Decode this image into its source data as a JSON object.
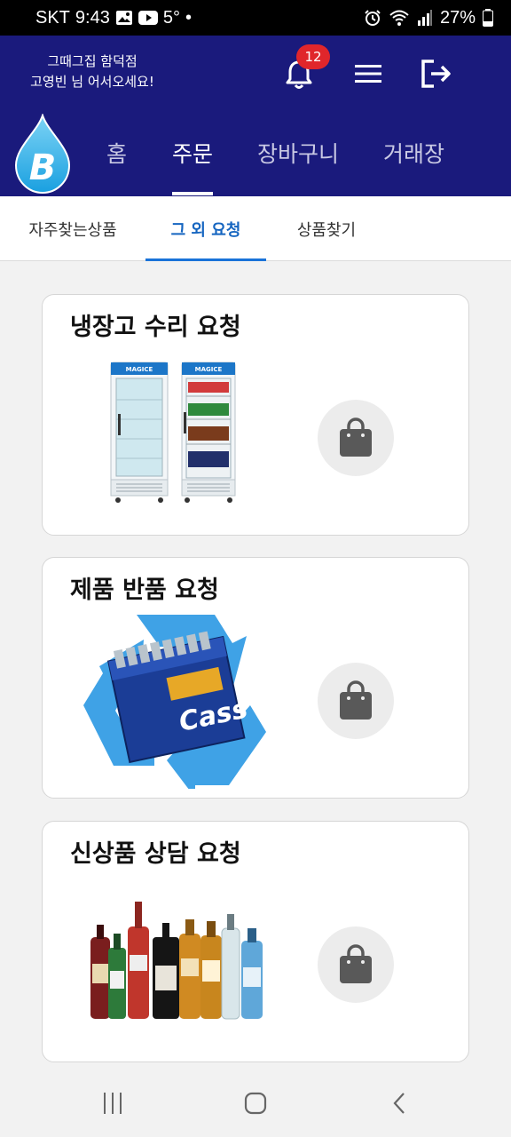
{
  "status_bar": {
    "carrier": "SKT",
    "time": "9:43",
    "temperature": "5°",
    "dot": "•",
    "battery": "27%",
    "icons": [
      "image-icon",
      "youtube-icon",
      "alarm-icon",
      "wifi-icon",
      "signal-icon",
      "battery-icon"
    ]
  },
  "header": {
    "store_name": "그때그집 함덕점",
    "welcome": "고영빈 님 어서오세요!",
    "notification_count": "12",
    "logo_letter": "B",
    "brand_color": "#1a1a7c"
  },
  "main_nav": [
    {
      "label": "홈",
      "active": false
    },
    {
      "label": "주문",
      "active": true
    },
    {
      "label": "장바구니",
      "active": false
    },
    {
      "label": "거래장",
      "active": false
    }
  ],
  "sub_tabs": [
    {
      "label": "자주찾는상품",
      "active": false
    },
    {
      "label": "그 외 요청",
      "active": true
    },
    {
      "label": "상품찾기",
      "active": false
    }
  ],
  "cards": [
    {
      "title": "냉장고 수리 요청",
      "image": "refrigerators-image",
      "icon": "shopping-bag-icon"
    },
    {
      "title": "제품 반품 요청",
      "image": "recycle-beer-crate-image",
      "icon": "shopping-bag-icon"
    },
    {
      "title": "신상품 상담 요청",
      "image": "liquor-bottles-image",
      "icon": "shopping-bag-icon"
    }
  ],
  "fridge_brand": "MAGICE",
  "crate_brand": "Cass",
  "system_nav": [
    "recent-apps-icon",
    "home-icon",
    "back-icon"
  ],
  "colors": {
    "accent": "#1a73d9",
    "badge": "#e0262b",
    "recycle": "#3fa2e6"
  }
}
